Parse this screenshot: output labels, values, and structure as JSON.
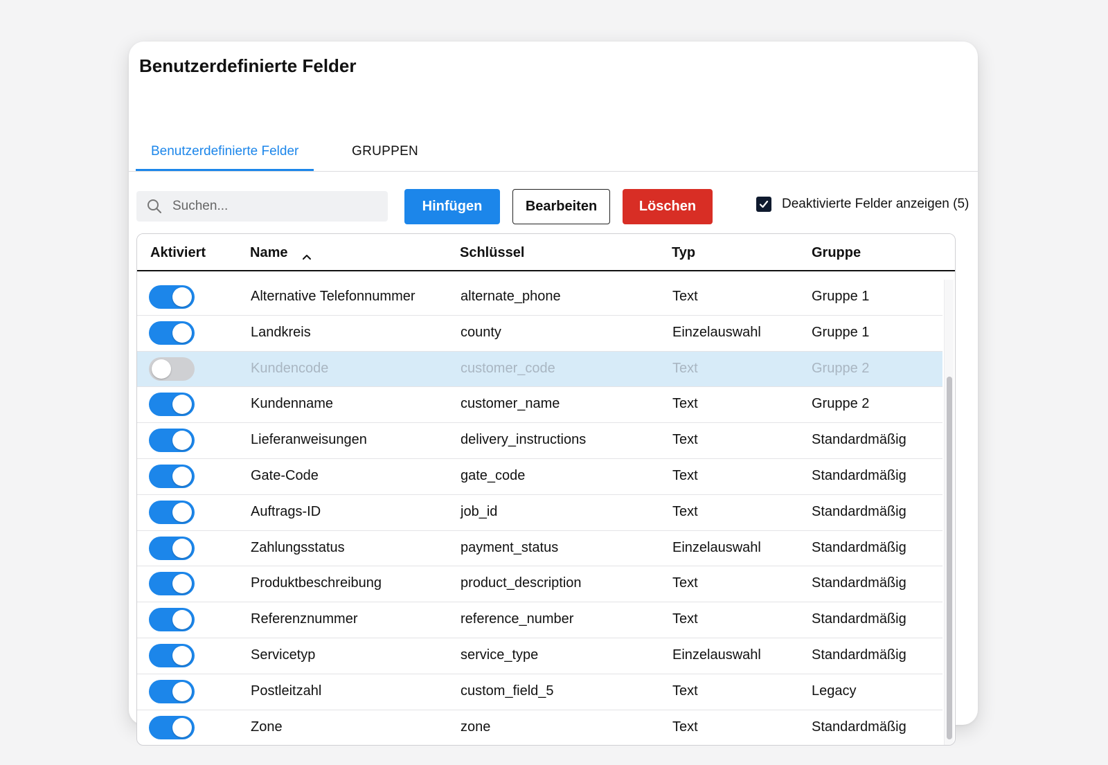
{
  "window": {
    "title": "Benutzerdefinierte Felder"
  },
  "tabs": [
    {
      "label": "Benutzerdefinierte Felder",
      "active": true
    },
    {
      "label": "GRUPPEN",
      "active": false
    }
  ],
  "toolbar": {
    "search_placeholder": "Suchen...",
    "add_label": "Hinfügen",
    "edit_label": "Bearbeiten",
    "delete_label": "Löschen",
    "show_disabled_label": "Deaktivierte Felder anzeigen (5)",
    "show_disabled_checked": true
  },
  "colors": {
    "accent": "#1c86ea",
    "danger": "#d82e25",
    "disabled_row": "#d7ebf8"
  },
  "table": {
    "headers": {
      "enabled": "Aktiviert",
      "name": "Name",
      "key": "Schlüssel",
      "type": "Typ",
      "group": "Gruppe"
    },
    "sort": {
      "column": "name",
      "direction": "ascending"
    },
    "rows": [
      {
        "enabled": true,
        "name": "Alternative Telefonnummer",
        "key": "alternate_phone",
        "type": "Text",
        "group": "Gruppe 1"
      },
      {
        "enabled": true,
        "name": "Landkreis",
        "key": "county",
        "type": "Einzelauswahl",
        "group": "Gruppe 1"
      },
      {
        "enabled": false,
        "name": "Kundencode",
        "key": "customer_code",
        "type": "Text",
        "group": "Gruppe 2"
      },
      {
        "enabled": true,
        "name": "Kundenname",
        "key": "customer_name",
        "type": "Text",
        "group": "Gruppe 2"
      },
      {
        "enabled": true,
        "name": "Lieferanweisungen",
        "key": "delivery_instructions",
        "type": "Text",
        "group": "Standardmäßig"
      },
      {
        "enabled": true,
        "name": "Gate-Code",
        "key": "gate_code",
        "type": "Text",
        "group": "Standardmäßig"
      },
      {
        "enabled": true,
        "name": "Auftrags-ID",
        "key": "job_id",
        "type": "Text",
        "group": "Standardmäßig"
      },
      {
        "enabled": true,
        "name": "Zahlungsstatus",
        "key": "payment_status",
        "type": "Einzelauswahl",
        "group": "Standardmäßig"
      },
      {
        "enabled": true,
        "name": "Produktbeschreibung",
        "key": "product_description",
        "type": "Text",
        "group": "Standardmäßig"
      },
      {
        "enabled": true,
        "name": "Referenznummer",
        "key": "reference_number",
        "type": "Text",
        "group": "Standardmäßig"
      },
      {
        "enabled": true,
        "name": "Servicetyp",
        "key": "service_type",
        "type": "Einzelauswahl",
        "group": "Standardmäßig"
      },
      {
        "enabled": true,
        "name": "Postleitzahl",
        "key": "custom_field_5",
        "type": "Text",
        "group": "Legacy"
      },
      {
        "enabled": true,
        "name": "Zone",
        "key": "zone",
        "type": "Text",
        "group": "Standardmäßig"
      }
    ]
  }
}
